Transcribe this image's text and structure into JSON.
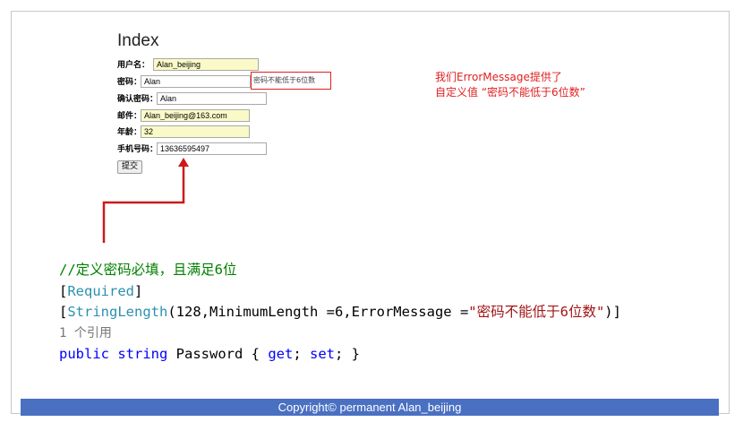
{
  "page": {
    "title": "Index"
  },
  "form": {
    "fields": [
      {
        "label": "用户名：",
        "value": "Alan_beijing"
      },
      {
        "label": "密码：",
        "value": "Alan"
      },
      {
        "label": "确认密码：",
        "value": "Alan"
      },
      {
        "label": "邮件：",
        "value": "Alan_beijing@163.com"
      },
      {
        "label": "年龄：",
        "value": "32"
      },
      {
        "label": "手机号码：",
        "value": "13636595497"
      }
    ],
    "error_message": "密码不能低于6位数",
    "submit_label": "提交"
  },
  "annotation": {
    "line1": "我们ErrorMessage提供了",
    "line2": "自定义值 “密码不能低于6位数”",
    "color": "#e02020"
  },
  "code": {
    "comment": "//定义密码必填，且满足6位",
    "required_attr": "Required",
    "stringlength_attr": "StringLength",
    "stringlength_args": "(128,MinimumLength =6,ErrorMessage =",
    "stringlength_string": "\"密码不能低于6位数\"",
    "stringlength_close": ")]",
    "refs": "1 个引用",
    "kw_public": "public",
    "kw_string": "string",
    "property_name": " Password { ",
    "kw_get": "get",
    "kw_set": "set"
  },
  "footer": {
    "text": "Copyright© permanent  Alan_beijing",
    "bg": "#4a70c2"
  }
}
